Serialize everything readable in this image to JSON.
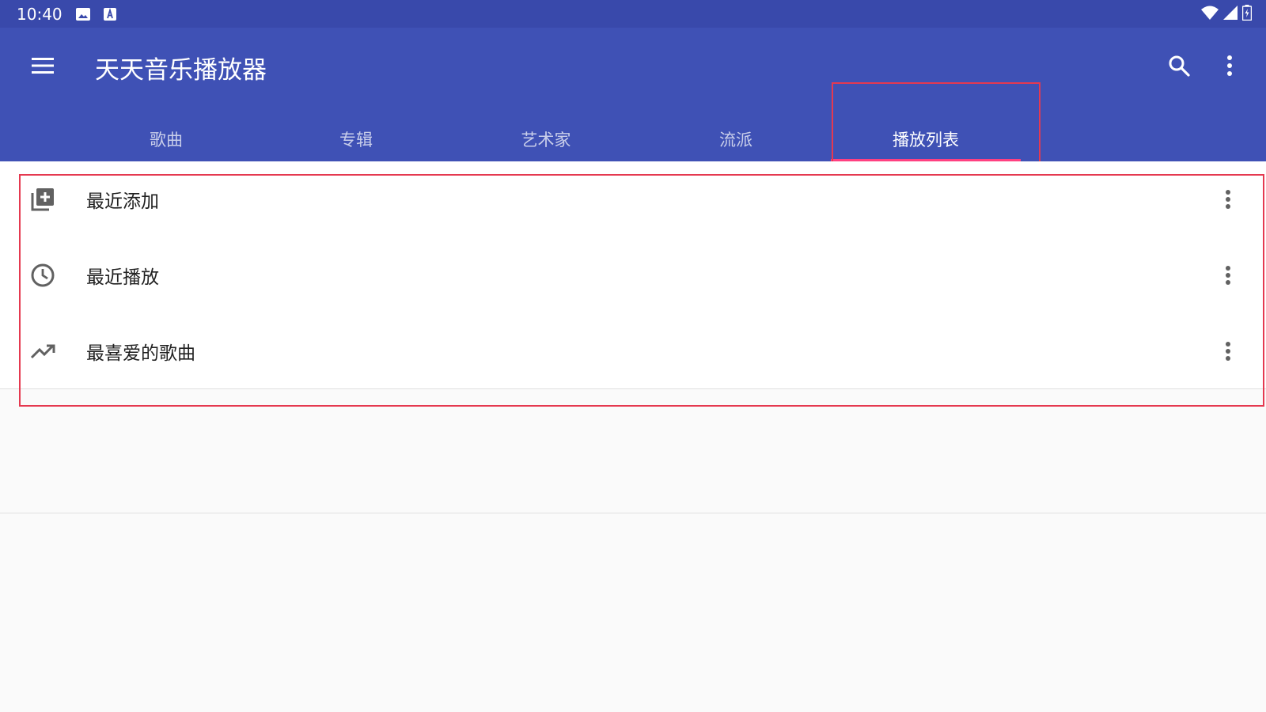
{
  "status_bar": {
    "time": "10:40",
    "icons": [
      "image-icon",
      "a-icon",
      "wifi-icon",
      "signal-icon",
      "battery-charging-icon"
    ]
  },
  "app_bar": {
    "title": "天天音乐播放器",
    "menu_icon": "hamburger-menu-icon",
    "search_icon": "search-icon",
    "more_icon": "more-vertical-icon",
    "background": "#3f51b5",
    "status_background": "#3949ab"
  },
  "tabs": [
    {
      "label": "歌曲",
      "active": false
    },
    {
      "label": "专辑",
      "active": false
    },
    {
      "label": "艺术家",
      "active": false
    },
    {
      "label": "流派",
      "active": false
    },
    {
      "label": "播放列表",
      "active": true
    }
  ],
  "playlists": [
    {
      "label": "最近添加",
      "icon": "playlist-add-icon"
    },
    {
      "label": "最近播放",
      "icon": "clock-icon"
    },
    {
      "label": "最喜爱的歌曲",
      "icon": "trending-up-icon"
    }
  ],
  "colors": {
    "accent": "#ff4081",
    "highlight_box": "#e53950"
  }
}
